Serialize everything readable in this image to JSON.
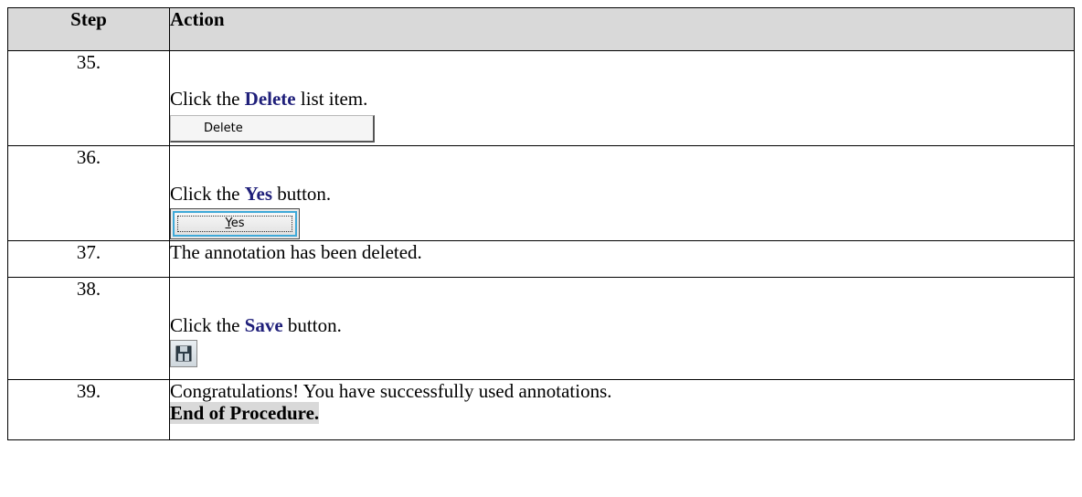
{
  "header": {
    "step": "Step",
    "action": "Action"
  },
  "rows": [
    {
      "num": "35.",
      "pre": "Click the ",
      "keyword": "Delete",
      "post": " list item.",
      "widget_label": "Delete"
    },
    {
      "num": "36.",
      "pre": "Click the ",
      "keyword": "Yes",
      "post": " button.",
      "widget_label": "Yes"
    },
    {
      "num": "37.",
      "text": "The annotation has been deleted."
    },
    {
      "num": "38.",
      "pre": "Click the ",
      "keyword": "Save",
      "post": " button.",
      "widget_icon": "save-icon"
    },
    {
      "num": "39.",
      "text": "Congratulations! You have successfully used annotations.",
      "end_label": "End of Procedure."
    }
  ],
  "colors": {
    "keyword": "#1f1f7a",
    "header_bg": "#d9d9d9",
    "focus_ring": "#3fa9d8"
  }
}
